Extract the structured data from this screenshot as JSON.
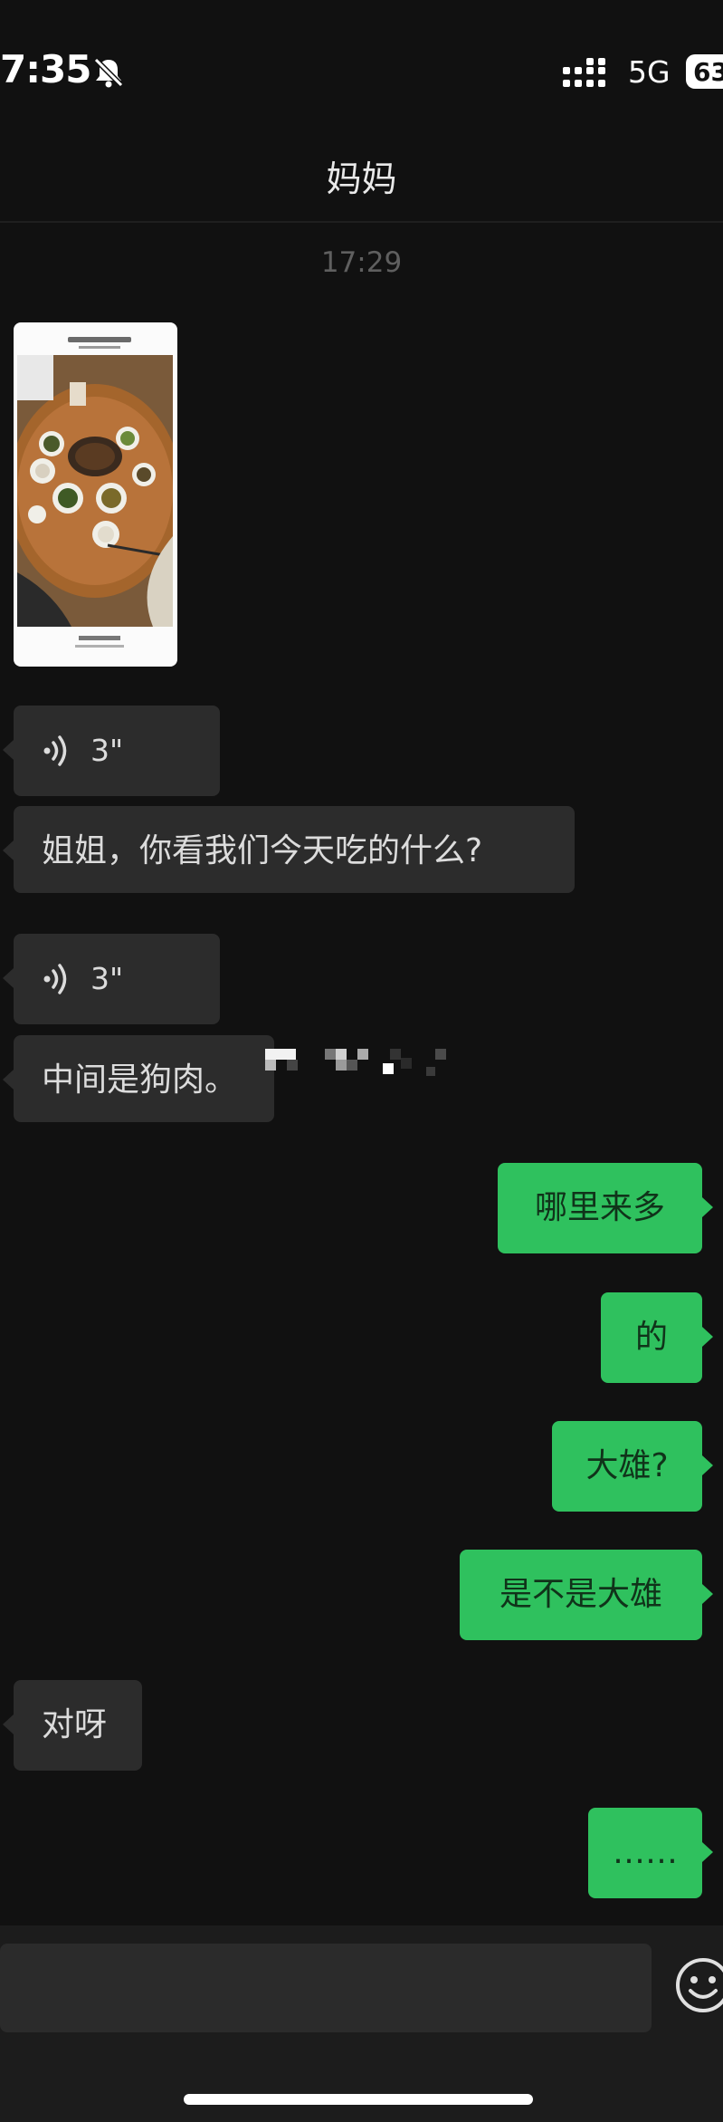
{
  "status_bar": {
    "time": "7:35",
    "network": "5G",
    "battery": "63",
    "icons": [
      "bell-mute-icon",
      "signal-icon",
      "battery-icon"
    ]
  },
  "header": {
    "title": "妈妈"
  },
  "timestamp": "17:29",
  "messages": [
    {
      "type": "image",
      "from": "contact",
      "description_icon": "photo-thumbnail"
    },
    {
      "type": "voice",
      "from": "contact",
      "duration": "3\""
    },
    {
      "type": "text",
      "from": "contact",
      "text": "姐姐，你看我们今天吃的什么?"
    },
    {
      "type": "voice",
      "from": "contact",
      "duration": "3\""
    },
    {
      "type": "text",
      "from": "contact",
      "text": "中间是狗肉。"
    },
    {
      "type": "text",
      "from": "me",
      "text": "哪里来多"
    },
    {
      "type": "text",
      "from": "me",
      "text": "的"
    },
    {
      "type": "text",
      "from": "me",
      "text": "大雄?"
    },
    {
      "type": "text",
      "from": "me",
      "text": "是不是大雄"
    },
    {
      "type": "text",
      "from": "contact",
      "text": "对呀"
    },
    {
      "type": "text",
      "from": "me",
      "text": "……"
    }
  ],
  "input": {
    "placeholder": "",
    "value": ""
  },
  "colors": {
    "background": "#111111",
    "incoming_bubble": "#2c2c2c",
    "outgoing_bubble": "#2fc15e",
    "timestamp": "#5f5f5f"
  }
}
